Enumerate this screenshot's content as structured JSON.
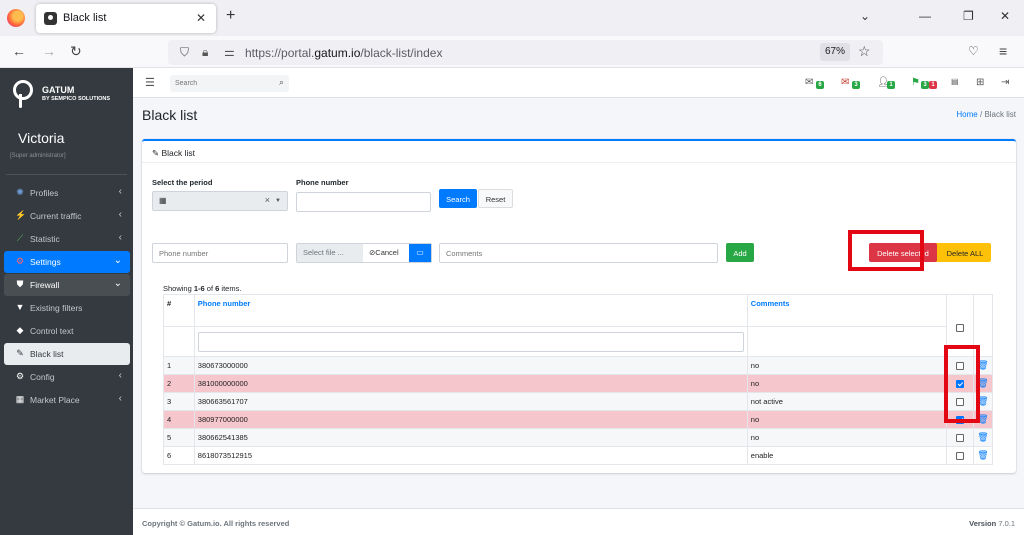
{
  "browser": {
    "tab_title": "Black list",
    "url_prefix": "https://portal.",
    "url_host": "gatum.io",
    "url_path": "/black-list/index",
    "zoom": "67%"
  },
  "sidebar": {
    "brand_name": "GATUM",
    "brand_sub": "BY SEMPICO SOLUTIONS",
    "user_name": "Victoria",
    "user_role": "[Super administrator]",
    "items": [
      {
        "label": "Profiles",
        "icon": "profiles-icon"
      },
      {
        "label": "Current traffic",
        "icon": "traffic-icon"
      },
      {
        "label": "Statistic",
        "icon": "chart-icon"
      },
      {
        "label": "Settings",
        "icon": "settings-icon"
      },
      {
        "label": "Firewall",
        "icon": "shield-icon"
      },
      {
        "label": "Existing filters",
        "icon": "filter-icon"
      },
      {
        "label": "Control text",
        "icon": "eraser-icon"
      },
      {
        "label": "Black list",
        "icon": "broom-icon"
      },
      {
        "label": "Config",
        "icon": "gear-icon"
      },
      {
        "label": "Market Place",
        "icon": "grid-icon"
      }
    ]
  },
  "header": {
    "search_placeholder": "Search",
    "badges": [
      "6",
      "3",
      "1",
      "3",
      "1"
    ]
  },
  "page": {
    "title": "Black list",
    "breadcrumb_home": "Home",
    "breadcrumb_sep": "/",
    "breadcrumb_current": "Black list"
  },
  "card": {
    "title": "Black list",
    "period_label": "Select the period",
    "phone_label": "Phone number",
    "search_button": "Search",
    "reset_button": "Reset",
    "phone_placeholder": "Phone number",
    "file_placeholder": "Select file ...",
    "cancel_label": "Cancel",
    "comments_placeholder": "Comments",
    "add_button": "Add",
    "delete_selected_button": "Delete selected",
    "delete_all_button": "Delete ALL"
  },
  "table": {
    "summary_prefix": "Showing ",
    "summary_range": "1-6",
    "summary_mid": " of ",
    "summary_total": "6",
    "summary_suffix": " items.",
    "headers": {
      "num": "#",
      "phone": "Phone number",
      "comments": "Comments"
    },
    "rows": [
      {
        "num": "1",
        "phone": "380673000000",
        "comment": "no",
        "checked": false
      },
      {
        "num": "2",
        "phone": "381000000000",
        "comment": "no",
        "checked": true
      },
      {
        "num": "3",
        "phone": "380663561707",
        "comment": "not active",
        "checked": false
      },
      {
        "num": "4",
        "phone": "380977000000",
        "comment": "no",
        "checked": true
      },
      {
        "num": "5",
        "phone": "380662541385",
        "comment": "no",
        "checked": false
      },
      {
        "num": "6",
        "phone": "8618073512915",
        "comment": "enable",
        "checked": false
      }
    ]
  },
  "footer": {
    "copyright": "Copyright © Gatum.io. All rights reserved",
    "version_label": "Version",
    "version": "7.0.1"
  },
  "colors": {
    "accent": "#007bff",
    "sidebar_bg": "#343a40",
    "selected_row": "#f5c6cb",
    "annotation": "#e30613"
  }
}
